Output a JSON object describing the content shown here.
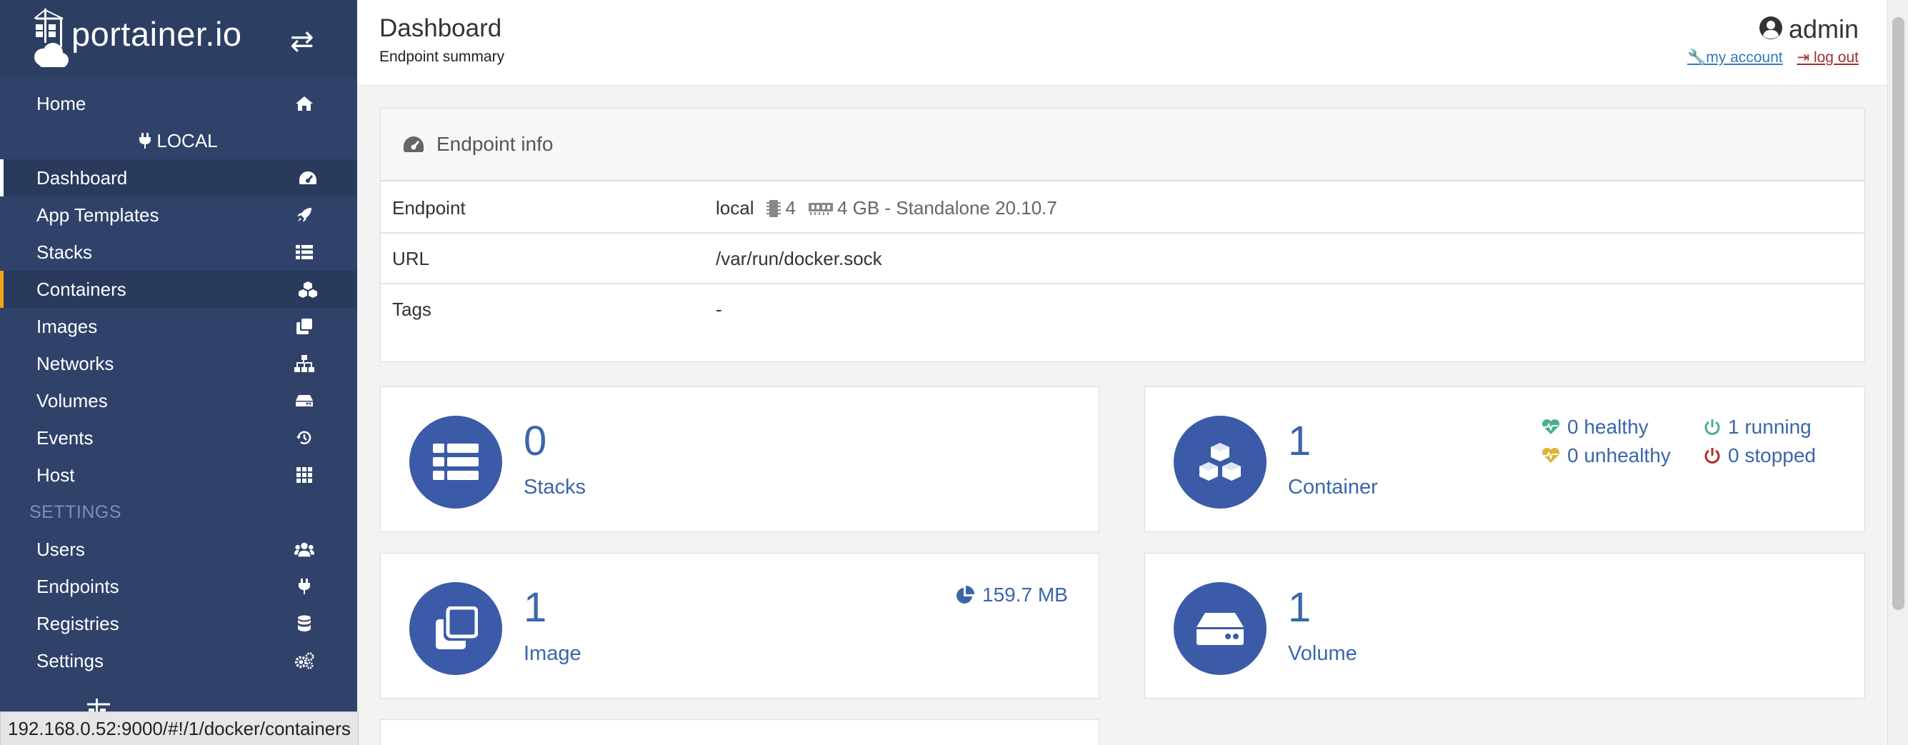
{
  "brand": {
    "name": "portainer.io"
  },
  "sidebar": {
    "home": "Home",
    "endpoint_name": "LOCAL",
    "items": [
      {
        "label": "Dashboard",
        "icon": "tachometer-icon"
      },
      {
        "label": "App Templates",
        "icon": "rocket-icon"
      },
      {
        "label": "Stacks",
        "icon": "th-list-icon"
      },
      {
        "label": "Containers",
        "icon": "cubes-icon"
      },
      {
        "label": "Images",
        "icon": "clone-icon"
      },
      {
        "label": "Networks",
        "icon": "sitemap-icon"
      },
      {
        "label": "Volumes",
        "icon": "hdd-icon"
      },
      {
        "label": "Events",
        "icon": "history-icon"
      },
      {
        "label": "Host",
        "icon": "th-icon"
      }
    ],
    "settings_heading": "SETTINGS",
    "settings_items": [
      {
        "label": "Users",
        "icon": "users-icon"
      },
      {
        "label": "Endpoints",
        "icon": "plug-icon"
      },
      {
        "label": "Registries",
        "icon": "database-icon"
      },
      {
        "label": "Settings",
        "icon": "cogs-icon"
      }
    ]
  },
  "statusbar": {
    "url": "192.168.0.52:9000/#!/1/docker/containers"
  },
  "header": {
    "title": "Dashboard",
    "subtitle": "Endpoint summary",
    "username": "admin",
    "my_account": "my account",
    "log_out": "log out"
  },
  "endpoint_info": {
    "title": "Endpoint info",
    "rows": {
      "endpoint_label": "Endpoint",
      "endpoint_name": "local",
      "cpu": "4",
      "memory": "4 GB - Standalone 20.10.7",
      "url_label": "URL",
      "url_value": "/var/run/docker.sock",
      "tags_label": "Tags",
      "tags_value": "-"
    }
  },
  "stats": {
    "stacks": {
      "count": "0",
      "label": "Stacks"
    },
    "containers": {
      "count": "1",
      "label": "Container",
      "healthy": "0 healthy",
      "unhealthy": "0 unhealthy",
      "running": "1 running",
      "stopped": "0 stopped"
    },
    "images": {
      "count": "1",
      "label": "Image",
      "size": "159.7 MB"
    },
    "volumes": {
      "count": "1",
      "label": "Volume"
    }
  },
  "colors": {
    "sidebar_bg": "#30426a",
    "accent_blue": "#3b66ab",
    "healthy": "#4caf8a",
    "unhealthy": "#e2b236",
    "running": "#4caf8a",
    "stopped": "#b52a2a"
  }
}
